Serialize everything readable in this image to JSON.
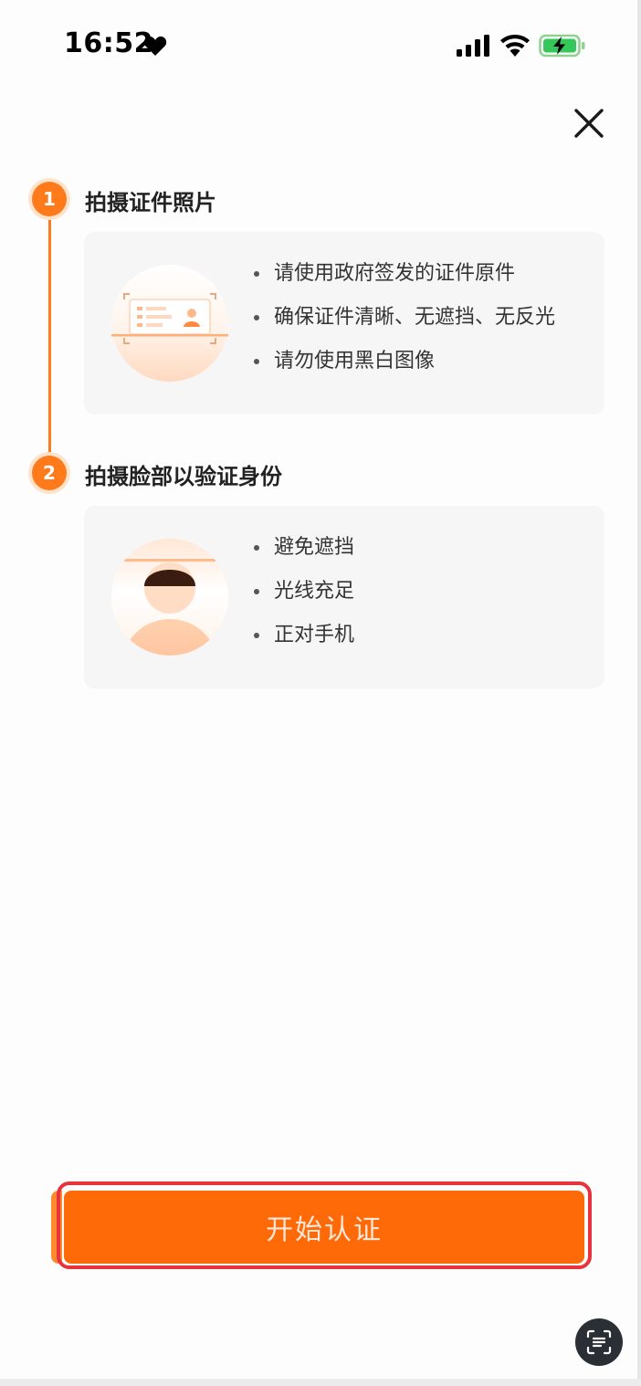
{
  "status_bar": {
    "time": "16:52"
  },
  "icons": {
    "heart": "heart-icon",
    "signal": "cellular-signal-icon",
    "wifi": "wifi-icon",
    "battery": "battery-charging-icon",
    "close": "close-icon",
    "scan": "scan-text-icon"
  },
  "colors": {
    "accent": "#ff7a1a",
    "button": "#ff6a08",
    "highlight_border": "#e8323c",
    "card_bg": "#f6f6f6"
  },
  "steps": [
    {
      "number": "1",
      "title": "拍摄证件照片",
      "tips": [
        "请使用政府签发的证件原件",
        "确保证件清晰、无遮挡、无反光",
        "请勿使用黑白图像"
      ]
    },
    {
      "number": "2",
      "title": "拍摄脸部以验证身份",
      "tips": [
        "避免遮挡",
        "光线充足",
        "正对手机"
      ]
    }
  ],
  "start_button": {
    "label": "开始认证"
  }
}
